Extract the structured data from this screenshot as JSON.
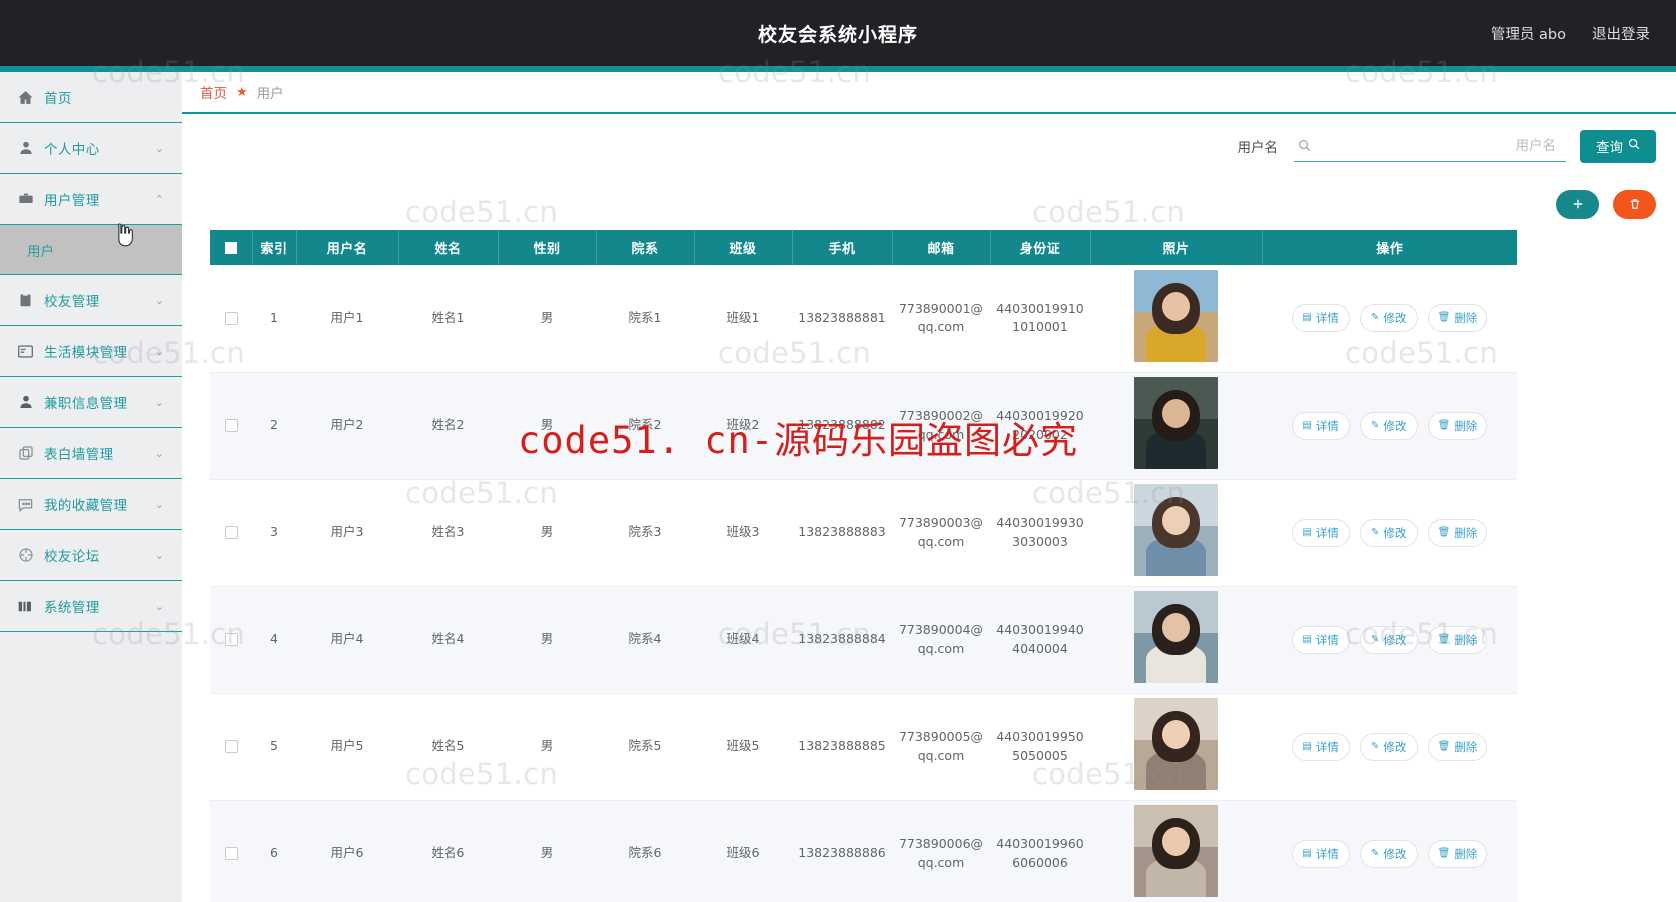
{
  "header": {
    "title": "校友会系统小程序",
    "admin_label": "管理员 abo",
    "logout_label": "退出登录"
  },
  "breadcrumb": {
    "home": "首页",
    "separator_icon": "star-icon",
    "current": "用户"
  },
  "sidebar": {
    "items": [
      {
        "label": "首页",
        "icon": "home-icon",
        "arrow": "",
        "active": false
      },
      {
        "label": "个人中心",
        "icon": "user-icon",
        "arrow": "⌄",
        "active": false
      },
      {
        "label": "用户管理",
        "icon": "briefcase-icon",
        "arrow": "⌃",
        "active": true
      },
      {
        "label": "校友管理",
        "icon": "clipboard-icon",
        "arrow": "⌄",
        "active": false
      },
      {
        "label": "生活模块管理",
        "icon": "envelope-icon",
        "arrow": "⌄",
        "active": false
      },
      {
        "label": "兼职信息管理",
        "icon": "person-icon",
        "arrow": "⌄",
        "active": false
      },
      {
        "label": "表白墙管理",
        "icon": "copy-icon",
        "arrow": "⌄",
        "active": false
      },
      {
        "label": "我的收藏管理",
        "icon": "comment-icon",
        "arrow": "⌄",
        "active": false
      },
      {
        "label": "校友论坛",
        "icon": "compass-icon",
        "arrow": "⌄",
        "active": false
      },
      {
        "label": "系统管理",
        "icon": "sliders-icon",
        "arrow": "⌄",
        "active": false
      }
    ],
    "submenu": {
      "label": "用户",
      "parent_index": 2
    }
  },
  "search": {
    "label": "用户名",
    "placeholder": "用户名",
    "value": "",
    "icon": "search-icon",
    "query_label": "查询",
    "query_icon": "search-icon"
  },
  "actions": {
    "add_label": "+",
    "add_icon": "plus-icon",
    "delete_icon": "trash-icon"
  },
  "table": {
    "columns": [
      "",
      "索引",
      "用户名",
      "姓名",
      "性别",
      "院系",
      "班级",
      "手机",
      "邮箱",
      "身份证",
      "照片",
      "操作"
    ],
    "rows": [
      {
        "index": "1",
        "username": "用户1",
        "name": "姓名1",
        "gender": "男",
        "department": "院系1",
        "class": "班级1",
        "phone": "13823888881",
        "email": "773890001@qq.com",
        "idcard": "440300199101010001",
        "photo": "portrait-1"
      },
      {
        "index": "2",
        "username": "用户2",
        "name": "姓名2",
        "gender": "男",
        "department": "院系2",
        "class": "班级2",
        "phone": "13823888882",
        "email": "773890002@qq.com",
        "idcard": "440300199202020002",
        "photo": "portrait-2"
      },
      {
        "index": "3",
        "username": "用户3",
        "name": "姓名3",
        "gender": "男",
        "department": "院系3",
        "class": "班级3",
        "phone": "13823888883",
        "email": "773890003@qq.com",
        "idcard": "440300199303030003",
        "photo": "portrait-3"
      },
      {
        "index": "4",
        "username": "用户4",
        "name": "姓名4",
        "gender": "男",
        "department": "院系4",
        "class": "班级4",
        "phone": "13823888884",
        "email": "773890004@qq.com",
        "idcard": "440300199404040004",
        "photo": "portrait-4"
      },
      {
        "index": "5",
        "username": "用户5",
        "name": "姓名5",
        "gender": "男",
        "department": "院系5",
        "class": "班级5",
        "phone": "13823888885",
        "email": "773890005@qq.com",
        "idcard": "440300199505050005",
        "photo": "portrait-5"
      },
      {
        "index": "6",
        "username": "用户6",
        "name": "姓名6",
        "gender": "男",
        "department": "院系6",
        "class": "班级6",
        "phone": "13823888886",
        "email": "773890006@qq.com",
        "idcard": "440300199606060006",
        "photo": "portrait-6"
      }
    ],
    "row_actions": {
      "detail_label": "详情",
      "edit_label": "修改",
      "delete_label": "删除",
      "detail_icon": "document-icon",
      "edit_icon": "pencil-icon",
      "delete_icon": "trash-icon"
    }
  },
  "watermarks": {
    "small_text": "code51.cn",
    "notice_text": "code51. cn-源码乐园盗图必究"
  },
  "colors": {
    "topbar": "#222226",
    "teal": "#0f9195",
    "table_header": "#12888c",
    "accent_orange": "#f2561a",
    "breadcrumb_home": "#e2573c",
    "sidebar_bg": "#eceef0",
    "submenu_active": "#c2c1c1"
  }
}
